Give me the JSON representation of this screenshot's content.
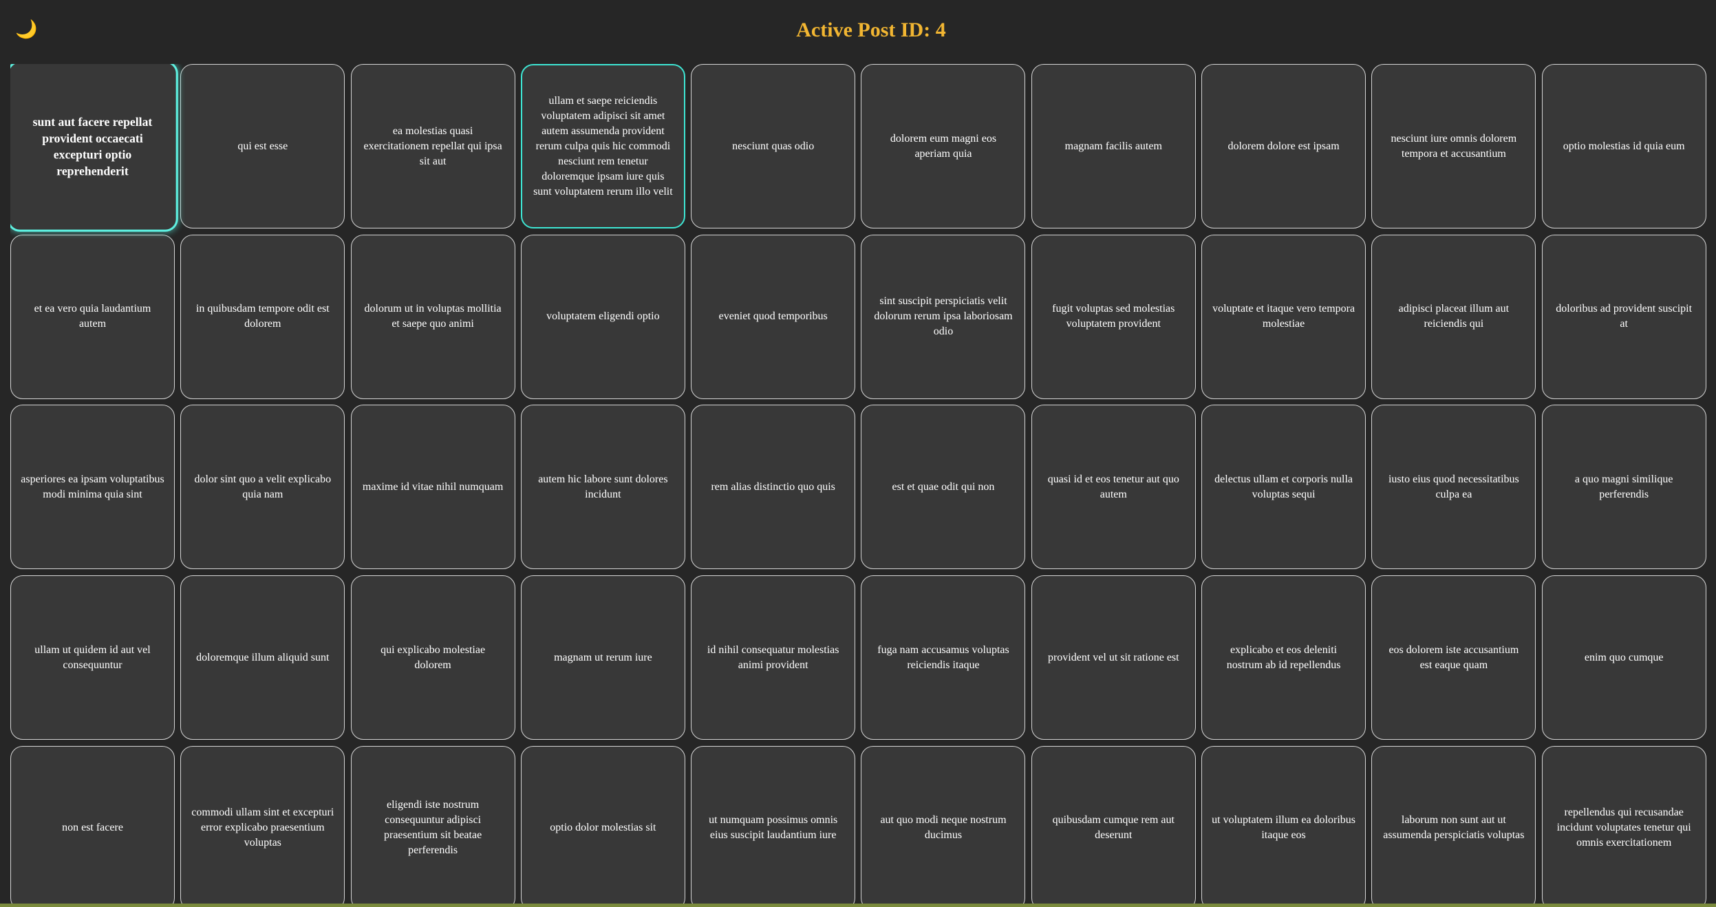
{
  "header": {
    "theme_toggle_icon": "moon-icon",
    "theme_toggle_glyph": "🌙",
    "title": "Active Post ID: 4"
  },
  "colors": {
    "background": "#262626",
    "card_background": "#383838",
    "card_border": "#d6d6d6",
    "active_border": "#3ee6d4",
    "title": "#f2b632"
  },
  "active_post_id": 4,
  "selected_post_id": 1,
  "posts": [
    {
      "id": 1,
      "title": "sunt aut facere repellat provident occaecati excepturi optio reprehenderit"
    },
    {
      "id": 2,
      "title": "qui est esse"
    },
    {
      "id": 3,
      "title": "ea molestias quasi exercitationem repellat qui ipsa sit aut"
    },
    {
      "id": 4,
      "title": "ullam et saepe reiciendis voluptatem adipisci sit amet autem assumenda provident rerum culpa quis hic commodi nesciunt rem tenetur doloremque ipsam iure quis sunt voluptatem rerum illo velit"
    },
    {
      "id": 5,
      "title": "nesciunt quas odio"
    },
    {
      "id": 6,
      "title": "dolorem eum magni eos aperiam quia"
    },
    {
      "id": 7,
      "title": "magnam facilis autem"
    },
    {
      "id": 8,
      "title": "dolorem dolore est ipsam"
    },
    {
      "id": 9,
      "title": "nesciunt iure omnis dolorem tempora et accusantium"
    },
    {
      "id": 10,
      "title": "optio molestias id quia eum"
    },
    {
      "id": 11,
      "title": "et ea vero quia laudantium autem"
    },
    {
      "id": 12,
      "title": "in quibusdam tempore odit est dolorem"
    },
    {
      "id": 13,
      "title": "dolorum ut in voluptas mollitia et saepe quo animi"
    },
    {
      "id": 14,
      "title": "voluptatem eligendi optio"
    },
    {
      "id": 15,
      "title": "eveniet quod temporibus"
    },
    {
      "id": 16,
      "title": "sint suscipit perspiciatis velit dolorum rerum ipsa laboriosam odio"
    },
    {
      "id": 17,
      "title": "fugit voluptas sed molestias voluptatem provident"
    },
    {
      "id": 18,
      "title": "voluptate et itaque vero tempora molestiae"
    },
    {
      "id": 19,
      "title": "adipisci placeat illum aut reiciendis qui"
    },
    {
      "id": 20,
      "title": "doloribus ad provident suscipit at"
    },
    {
      "id": 21,
      "title": "asperiores ea ipsam voluptatibus modi minima quia sint"
    },
    {
      "id": 22,
      "title": "dolor sint quo a velit explicabo quia nam"
    },
    {
      "id": 23,
      "title": "maxime id vitae nihil numquam"
    },
    {
      "id": 24,
      "title": "autem hic labore sunt dolores incidunt"
    },
    {
      "id": 25,
      "title": "rem alias distinctio quo quis"
    },
    {
      "id": 26,
      "title": "est et quae odit qui non"
    },
    {
      "id": 27,
      "title": "quasi id et eos tenetur aut quo autem"
    },
    {
      "id": 28,
      "title": "delectus ullam et corporis nulla voluptas sequi"
    },
    {
      "id": 29,
      "title": "iusto eius quod necessitatibus culpa ea"
    },
    {
      "id": 30,
      "title": "a quo magni similique perferendis"
    },
    {
      "id": 31,
      "title": "ullam ut quidem id aut vel consequuntur"
    },
    {
      "id": 32,
      "title": "doloremque illum aliquid sunt"
    },
    {
      "id": 33,
      "title": "qui explicabo molestiae dolorem"
    },
    {
      "id": 34,
      "title": "magnam ut rerum iure"
    },
    {
      "id": 35,
      "title": "id nihil consequatur molestias animi provident"
    },
    {
      "id": 36,
      "title": "fuga nam accusamus voluptas reiciendis itaque"
    },
    {
      "id": 37,
      "title": "provident vel ut sit ratione est"
    },
    {
      "id": 38,
      "title": "explicabo et eos deleniti nostrum ab id repellendus"
    },
    {
      "id": 39,
      "title": "eos dolorem iste accusantium est eaque quam"
    },
    {
      "id": 40,
      "title": "enim quo cumque"
    },
    {
      "id": 41,
      "title": "non est facere"
    },
    {
      "id": 42,
      "title": "commodi ullam sint et excepturi error explicabo praesentium voluptas"
    },
    {
      "id": 43,
      "title": "eligendi iste nostrum consequuntur adipisci praesentium sit beatae perferendis"
    },
    {
      "id": 44,
      "title": "optio dolor molestias sit"
    },
    {
      "id": 45,
      "title": "ut numquam possimus omnis eius suscipit laudantium iure"
    },
    {
      "id": 46,
      "title": "aut quo modi neque nostrum ducimus"
    },
    {
      "id": 47,
      "title": "quibusdam cumque rem aut deserunt"
    },
    {
      "id": 48,
      "title": "ut voluptatem illum ea doloribus itaque eos"
    },
    {
      "id": 49,
      "title": "laborum non sunt aut ut assumenda perspiciatis voluptas"
    },
    {
      "id": 50,
      "title": "repellendus qui recusandae incidunt voluptates tenetur qui omnis exercitationem"
    }
  ]
}
